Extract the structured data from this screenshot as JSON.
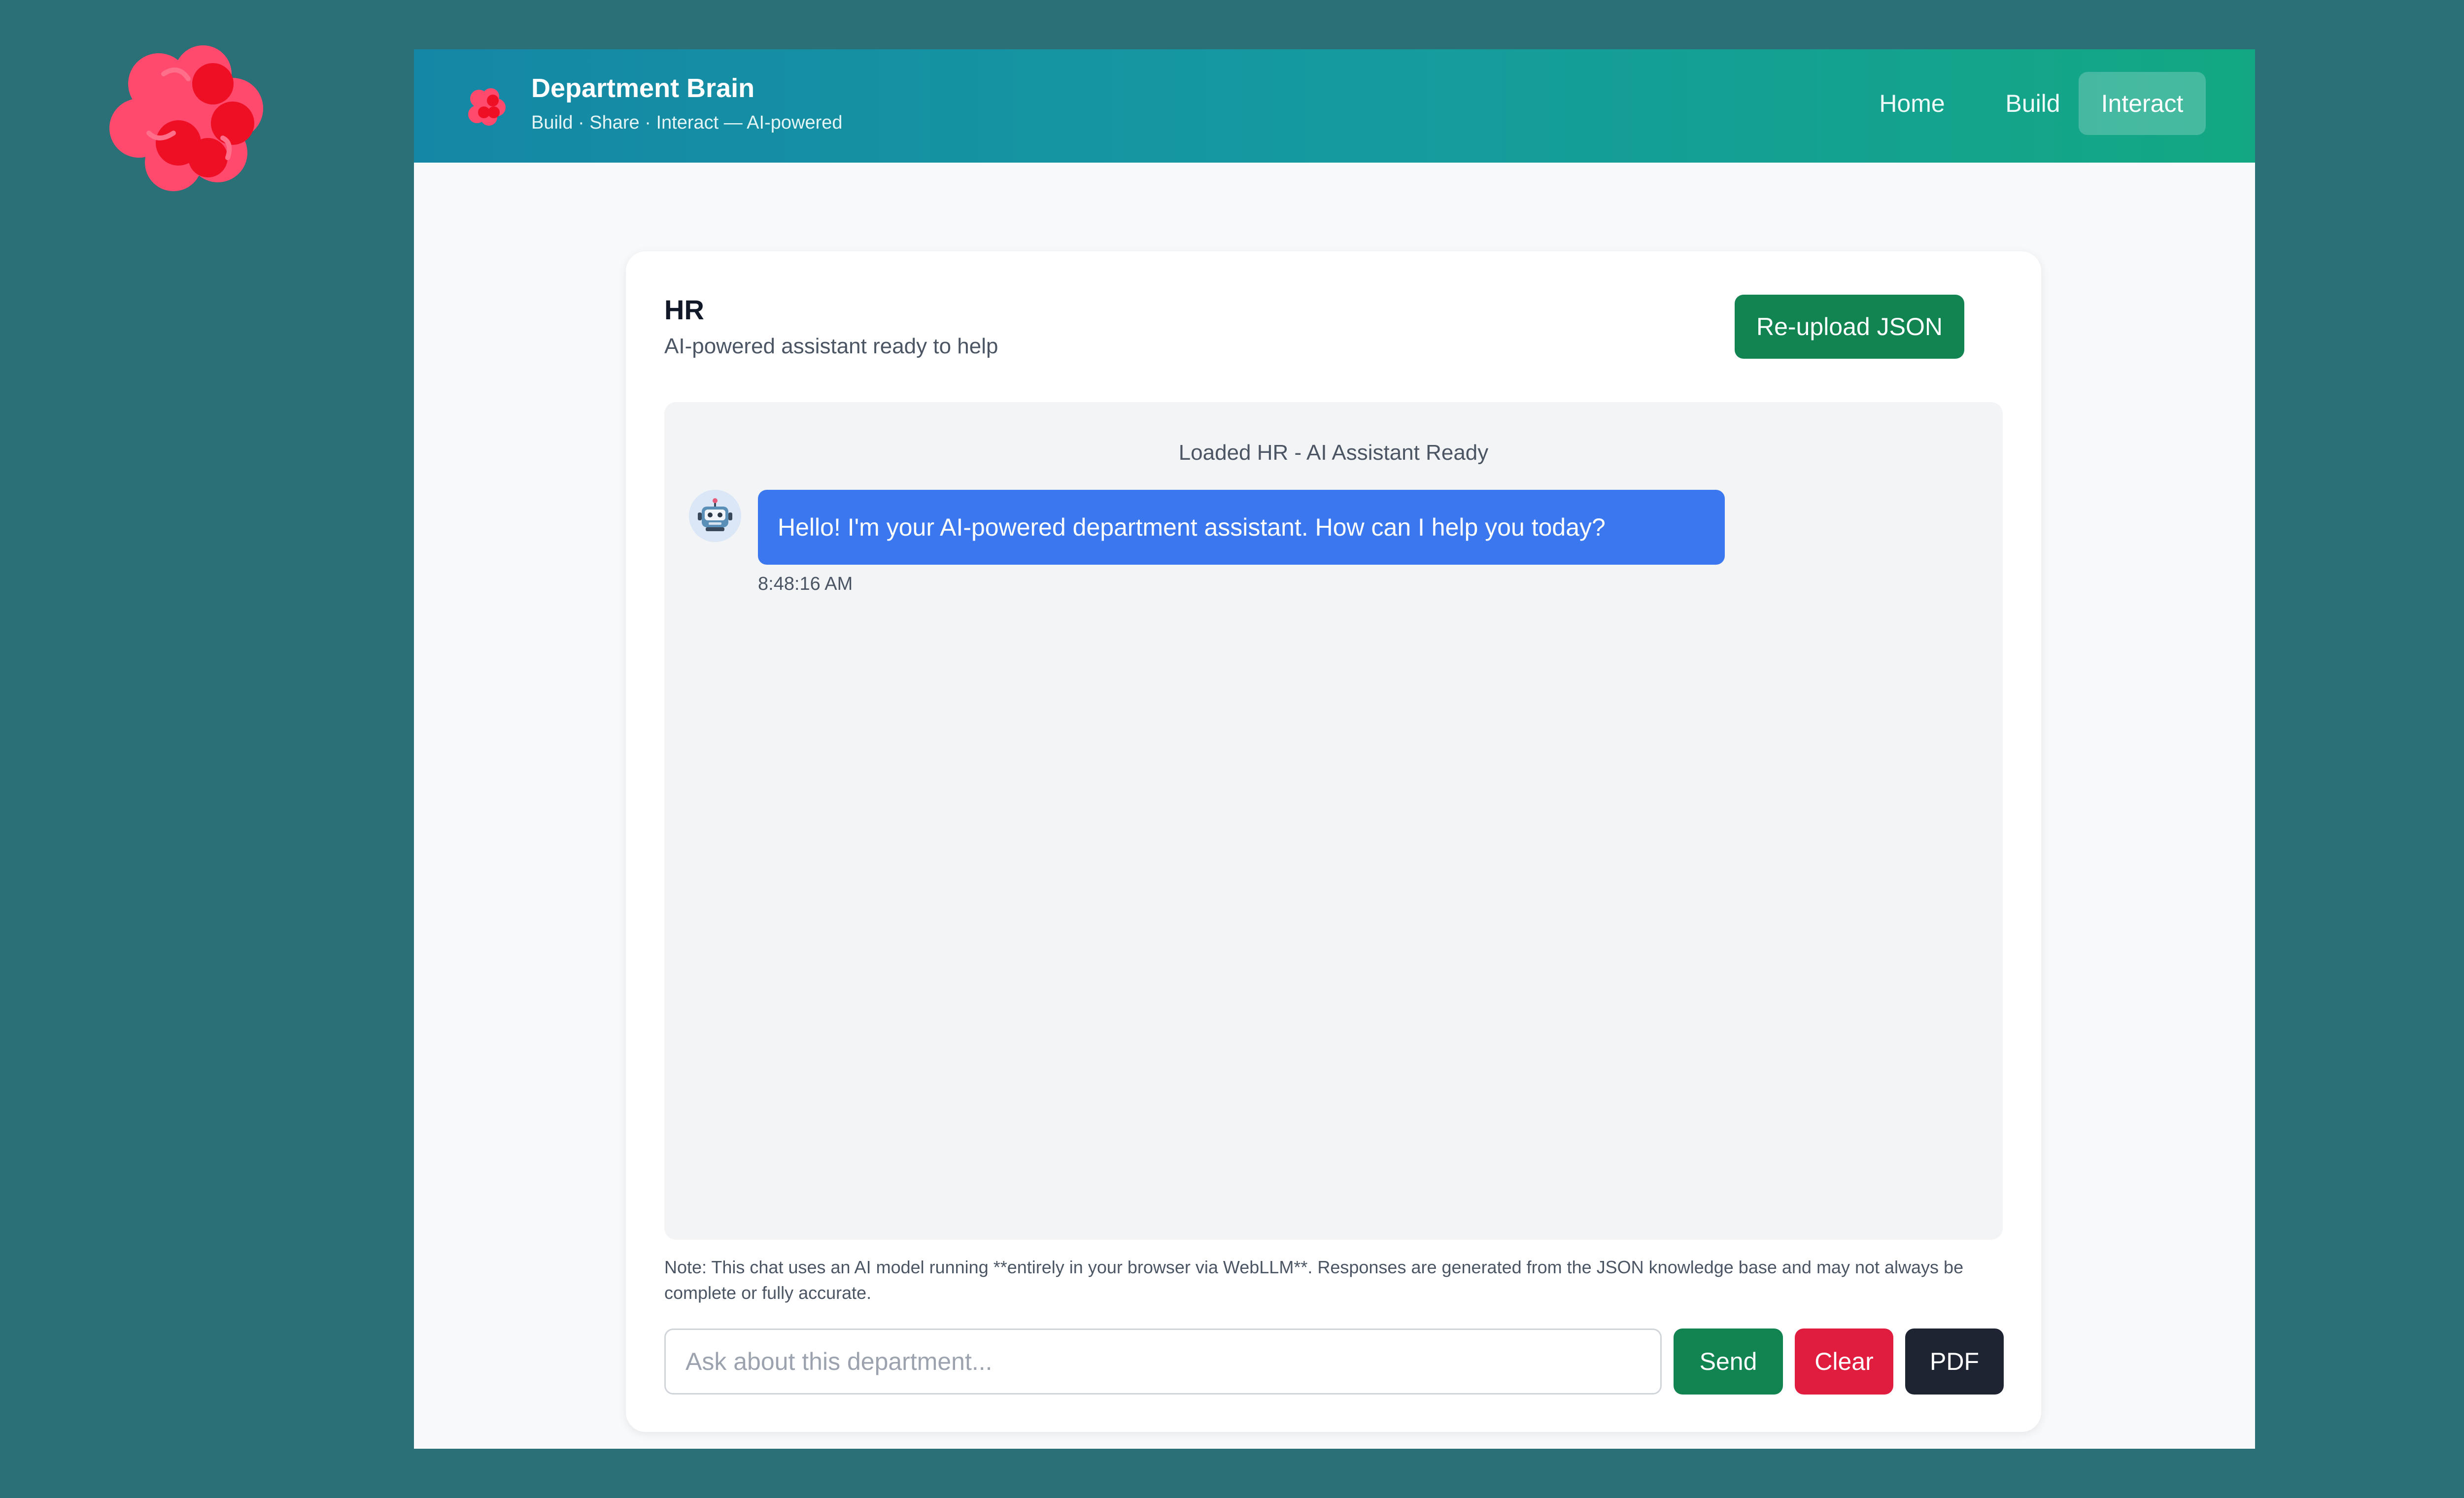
{
  "header": {
    "title": "Department Brain",
    "subtitle": "Build · Share · Interact — AI-powered",
    "nav": [
      {
        "label": "Home",
        "active": false
      },
      {
        "label": "Build",
        "active": false
      },
      {
        "label": "Interact",
        "active": true
      }
    ],
    "gradient_start": "#1587a6",
    "gradient_end": "#13a883"
  },
  "card": {
    "department": "HR",
    "subtitle": "AI-powered assistant ready to help",
    "reupload_label": "Re-upload JSON"
  },
  "chat": {
    "system_message": "Loaded HR - AI Assistant Ready",
    "messages": [
      {
        "sender": "bot",
        "avatar_icon": "robot-icon",
        "text": "Hello! I'm your AI-powered department assistant. How can I help you today?",
        "time": "8:48:16 AM"
      }
    ]
  },
  "note": "Note: This chat uses an AI model running **entirely in your browser via WebLLM**. Responses are generated from the JSON knowledge base and may not always be complete or fully accurate.",
  "input": {
    "placeholder": "Ask about this department...",
    "value": ""
  },
  "actions": {
    "send_label": "Send",
    "clear_label": "Clear",
    "pdf_label": "PDF"
  },
  "colors": {
    "background": "#2b6f77",
    "logo": "#ff3b5c",
    "send": "#128451",
    "clear": "#e11d3f",
    "pdf": "#1f2433",
    "bubble": "#3b78f0"
  }
}
